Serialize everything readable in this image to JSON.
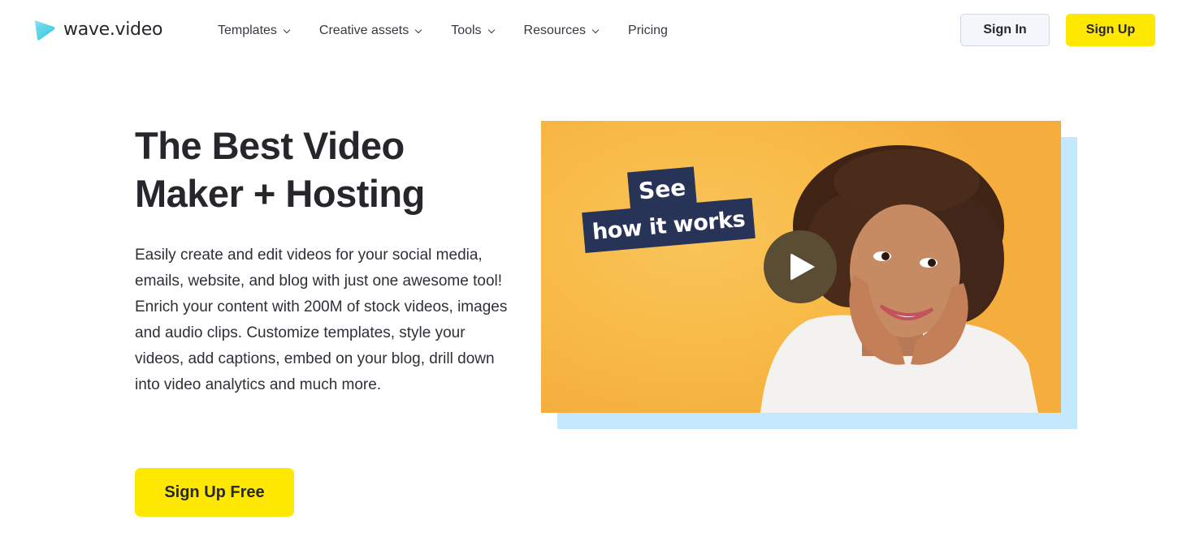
{
  "header": {
    "logo_text": "wave.video",
    "logo_icon": "play-triangle-logo-icon",
    "nav": [
      {
        "label": "Templates",
        "has_dropdown": true
      },
      {
        "label": "Creative assets",
        "has_dropdown": true
      },
      {
        "label": "Tools",
        "has_dropdown": true
      },
      {
        "label": "Resources",
        "has_dropdown": true
      },
      {
        "label": "Pricing",
        "has_dropdown": false
      }
    ],
    "sign_in_label": "Sign In",
    "sign_up_label": "Sign Up"
  },
  "hero": {
    "title": "The Best Video Maker + Hosting",
    "paragraph_1": "Easily create and edit videos for your social media, emails, website, and blog with just one awesome tool!",
    "paragraph_2": "Enrich your content with 200M of stock videos, images and audio clips. Customize templates, style your videos, add captions, embed on your blog, drill down into video analytics and much more.",
    "cta_label": "Sign Up Free"
  },
  "video": {
    "tag_line_1": "See",
    "tag_line_2": "how it works",
    "play_icon": "play-icon"
  },
  "colors": {
    "accent_yellow": "#ffe800",
    "video_background": "#f8bb48",
    "video_shadow": "#c4e8fd",
    "tag_navy": "#283358",
    "play_button": "#5b4c34",
    "text_dark": "#25272b"
  }
}
